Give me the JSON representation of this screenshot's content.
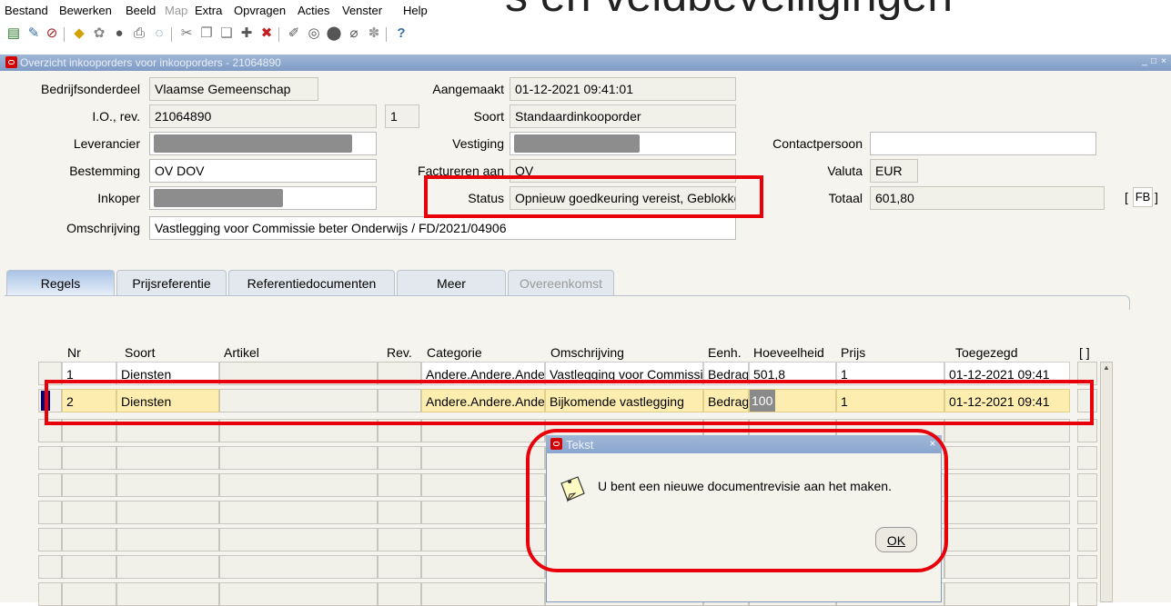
{
  "menu": [
    "Bestand",
    "Bewerken",
    "Beeld",
    "Map",
    "Extra",
    "Opvragen",
    "Acties",
    "Venster",
    "Help"
  ],
  "menu_disabled": "Map",
  "clipped_caption": "s en veldbeveiligingen",
  "toolbar_help": "?",
  "window": {
    "title": "Overzicht inkooporders voor inkooporders - 21064890",
    "minimize": "_",
    "maximize": "□",
    "close": "×"
  },
  "form": {
    "labels": {
      "bedrijfsonderdeel": "Bedrijfsonderdeel",
      "io_rev": "I.O., rev.",
      "leverancier": "Leverancier",
      "bestemming": "Bestemming",
      "inkoper": "Inkoper",
      "omschrijving": "Omschrijving",
      "aangemaakt": "Aangemaakt",
      "soort": "Soort",
      "vestiging": "Vestiging",
      "factureren": "Factureren aan",
      "status": "Status",
      "contactpersoon": "Contactpersoon",
      "valuta": "Valuta",
      "totaal": "Totaal"
    },
    "values": {
      "bedrijfsonderdeel": "Vlaamse Gemeenschap",
      "io": "21064890",
      "rev": "1",
      "bestemming": "OV DOV",
      "omschrijving": "Vastlegging voor Commissie beter Onderwijs / FD/2021/04906",
      "aangemaakt": "01-12-2021 09:41:01",
      "soort": "Standaardinkooporder",
      "factureren": "OV",
      "status": "Opnieuw goedkeuring vereist, Geblokkeerd",
      "contactpersoon": "",
      "valuta": "EUR",
      "totaal": "601,80",
      "fb_open": "[",
      "fb": "FB",
      "fb_close": "]"
    }
  },
  "tabs": [
    {
      "label": "Regels",
      "active": true
    },
    {
      "label": "Prijsreferentie"
    },
    {
      "label": "Referentiedocumenten"
    },
    {
      "label": "Meer"
    },
    {
      "label": "Overeenkomst",
      "disabled": true
    }
  ],
  "grid": {
    "columns": [
      "Nr",
      "Soort",
      "Artikel",
      "Rev.",
      "Categorie",
      "Omschrijving",
      "Eenh.",
      "Hoeveelheid",
      "Prijs",
      "Toegezegd",
      "[ ]"
    ],
    "rows": [
      {
        "nr": "1",
        "soort": "Diensten",
        "artikel": "",
        "rev": "",
        "categorie": "Andere.Andere.Andere",
        "omschrijving": "Vastlegging voor Commissie",
        "eenh": "Bedrag",
        "hoeveelheid": "501,8",
        "prijs": "1",
        "toegezegd": "01-12-2021 09:41"
      },
      {
        "nr": "2",
        "soort": "Diensten",
        "artikel": "",
        "rev": "",
        "categorie": "Andere.Andere.Andere",
        "omschrijving": "Bijkomende vastlegging",
        "eenh": "Bedrag",
        "hoeveelheid": "100",
        "prijs": "1",
        "toegezegd": "01-12-2021 09:41"
      }
    ]
  },
  "dialog": {
    "title": "Tekst",
    "message": "U bent een nieuwe documentrevisie aan het maken.",
    "ok": "OK",
    "close": "×"
  },
  "colors": {
    "annotation": "#e8000b",
    "titlebar": "#8aa6cf",
    "highlight_row": "#fdeeb0",
    "oracle_red": "#d40000"
  }
}
